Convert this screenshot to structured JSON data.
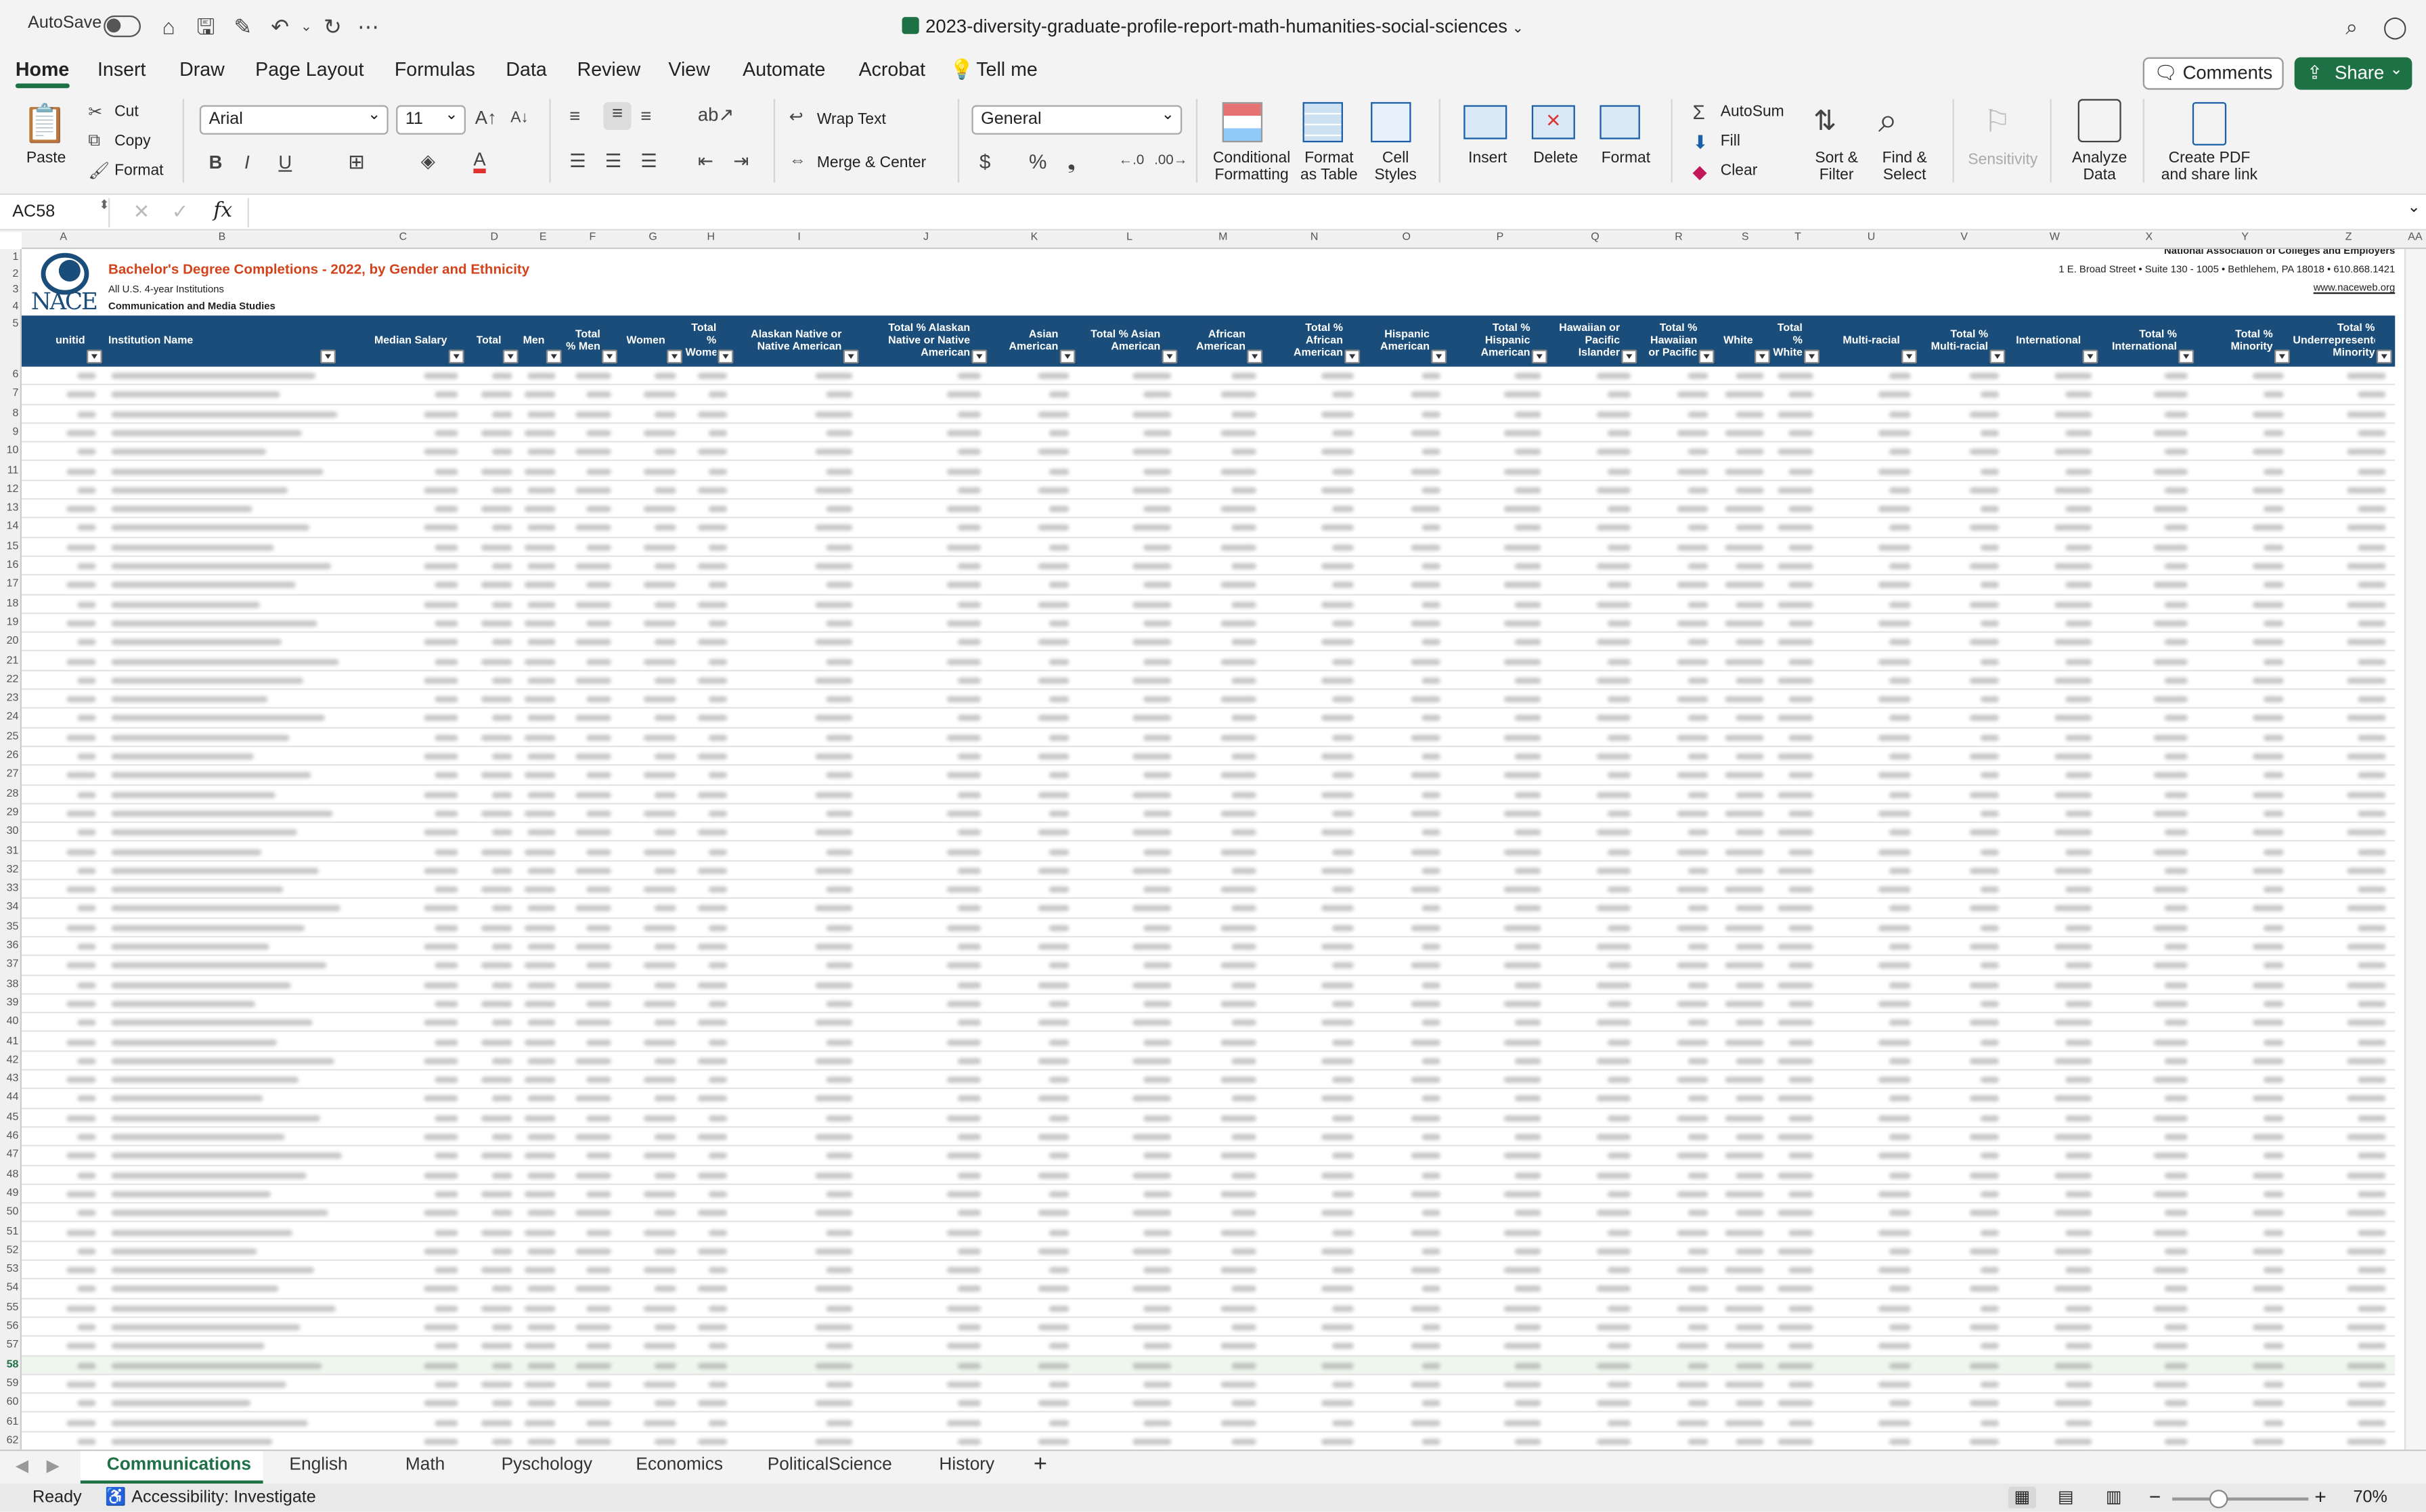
{
  "titlebar": {
    "autosave_label": "AutoSave",
    "document_title": "2023-diversity-graduate-profile-report-math-humanities-social-sciences"
  },
  "menu": {
    "tabs": [
      "Home",
      "Insert",
      "Draw",
      "Page Layout",
      "Formulas",
      "Data",
      "Review",
      "View",
      "Automate",
      "Acrobat"
    ],
    "tell_me": "Tell me",
    "comments_label": "Comments",
    "share_label": "Share"
  },
  "ribbon": {
    "paste": "Paste",
    "cut": "Cut",
    "copy": "Copy",
    "format_painter": "Format",
    "font_name": "Arial",
    "font_size": "11",
    "wrap_text": "Wrap Text",
    "merge_center": "Merge & Center",
    "number_format": "General",
    "conditional_formatting": [
      "Conditional",
      "Formatting"
    ],
    "format_as_table": [
      "Format",
      "as Table"
    ],
    "cell_styles": [
      "Cell",
      "Styles"
    ],
    "insert": "Insert",
    "delete": "Delete",
    "format": "Format",
    "autosum": "AutoSum",
    "fill": "Fill",
    "clear": "Clear",
    "sort_filter": [
      "Sort &",
      "Filter"
    ],
    "find_select": [
      "Find &",
      "Select"
    ],
    "sensitivity": "Sensitivity",
    "analyze_data": [
      "Analyze",
      "Data"
    ],
    "create_pdf": [
      "Create PDF",
      "and share link"
    ]
  },
  "formula_bar": {
    "name_box": "AC58",
    "fx": "fx",
    "value": ""
  },
  "grid": {
    "columns": [
      "A",
      "B",
      "C",
      "D",
      "E",
      "F",
      "G",
      "H",
      "I",
      "J",
      "K",
      "L",
      "M",
      "N",
      "O",
      "P",
      "Q",
      "R",
      "S",
      "T",
      "U",
      "V",
      "W",
      "X",
      "Y",
      "Z",
      "AA"
    ],
    "first_row": 1,
    "last_row": 62,
    "selected_row": 58
  },
  "sheet_header": {
    "logo_text": "NACE",
    "title": "Bachelor's Degree Completions - 2022, by Gender and Ethnicity",
    "subtitle": "All U.S. 4-year Institutions",
    "section": "Communication and Media Studies",
    "org_name": "National Association of Colleges and Employers",
    "address": "1 E. Broad Street • Suite 130 - 1005 • Bethlehem, PA 18018 • 610.868.1421",
    "website": "www.naceweb.org"
  },
  "table_headers": [
    "unitid",
    "Institution Name",
    "Median Salary",
    "Total",
    "Men",
    "Total % Men",
    "Women",
    "Total % Women",
    "Alaskan Native or Native American",
    "Total % Alaskan Native or Native American",
    "Asian American",
    "Total % Asian American",
    "African American",
    "Total % African American",
    "Hispanic American",
    "Total % Hispanic American",
    "Hawaiian or Pacific Islander",
    "Total % Hawaiian or Pacific Islander",
    "White",
    "Total % White",
    "Multi-racial",
    "Total % Multi-racial",
    "International",
    "Total % International",
    "Total % Minority",
    "Total % Underrepresented Minority"
  ],
  "sheet_tabs": [
    "Communications",
    "English",
    "Math",
    "Pyschology",
    "Economics",
    "PoliticalScience",
    "History"
  ],
  "active_sheet": "Communications",
  "status": {
    "ready": "Ready",
    "accessibility": "Accessibility: Investigate",
    "zoom": "70%"
  }
}
